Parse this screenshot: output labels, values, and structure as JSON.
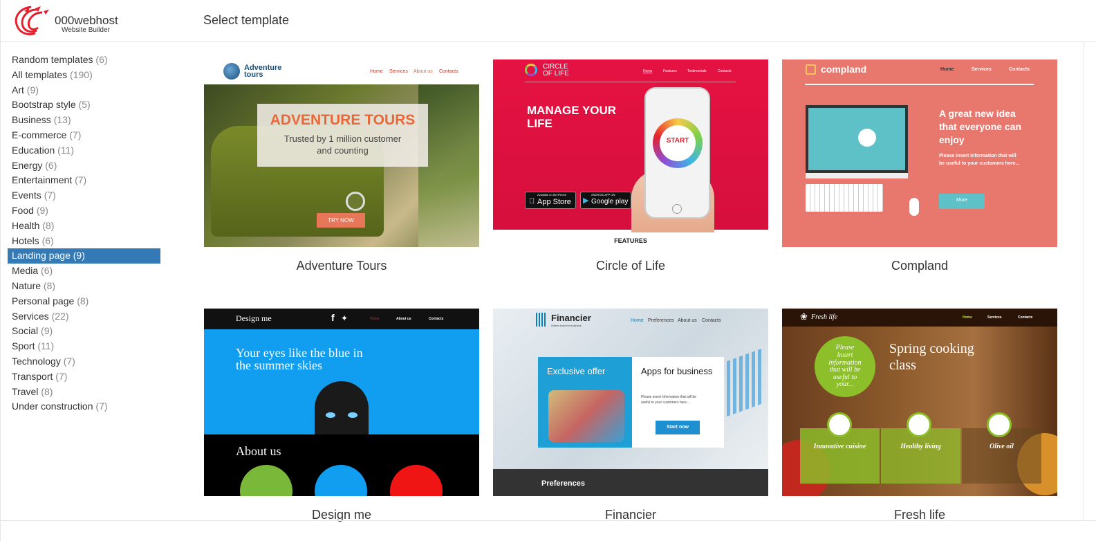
{
  "header": {
    "brand": "000webhost",
    "brand_sub": "Website Builder",
    "page_title": "Select template"
  },
  "categories": [
    {
      "label": "Random templates",
      "count": "(6)"
    },
    {
      "label": "All templates",
      "count": "(190)"
    },
    {
      "label": "Art",
      "count": "(9)"
    },
    {
      "label": "Bootstrap style",
      "count": "(5)"
    },
    {
      "label": "Business",
      "count": "(13)"
    },
    {
      "label": "E-commerce",
      "count": "(7)"
    },
    {
      "label": "Education",
      "count": "(11)"
    },
    {
      "label": "Energy",
      "count": "(6)"
    },
    {
      "label": "Entertainment",
      "count": "(7)"
    },
    {
      "label": "Events",
      "count": "(7)"
    },
    {
      "label": "Food",
      "count": "(9)"
    },
    {
      "label": "Health",
      "count": "(8)"
    },
    {
      "label": "Hotels",
      "count": "(6)"
    },
    {
      "label": "Landing page",
      "count": "(9)"
    },
    {
      "label": "Media",
      "count": "(6)"
    },
    {
      "label": "Nature",
      "count": "(8)"
    },
    {
      "label": "Personal page",
      "count": "(8)"
    },
    {
      "label": "Services",
      "count": "(22)"
    },
    {
      "label": "Social",
      "count": "(9)"
    },
    {
      "label": "Sport",
      "count": "(11)"
    },
    {
      "label": "Technology",
      "count": "(7)"
    },
    {
      "label": "Transport",
      "count": "(7)"
    },
    {
      "label": "Travel",
      "count": "(8)"
    },
    {
      "label": "Under construction",
      "count": "(7)"
    }
  ],
  "active_category": "Landing page",
  "templates": {
    "adventure": {
      "name": "Adventure Tours",
      "logo": "Adventure tours",
      "nav": [
        "Home",
        "Services",
        "About us",
        "Contacts"
      ],
      "headline": "ADVENTURE TOURS",
      "sub1": "Trusted by 1 million customer",
      "sub2": "and counting",
      "cta": "TRY NOW"
    },
    "circle": {
      "name": "Circle of Life",
      "logo1": "CIRCLE",
      "logo2": "OF LIFE",
      "nav": [
        "Home",
        "Features",
        "Testimonials",
        "Contacts"
      ],
      "headline1": "MANAGE YOUR",
      "headline2": "LIFE",
      "start": "START",
      "appstore_small": "Available on the iPhone",
      "appstore": "App Store",
      "gplay_small": "ANDROID APP ON",
      "gplay": "Google play",
      "features": "FEATURES"
    },
    "compland": {
      "name": "Compland",
      "logo": "compland",
      "nav": [
        "Home",
        "Services",
        "Contacts"
      ],
      "headline": [
        "A great new idea",
        "that everyone can",
        "enjoy"
      ],
      "body": [
        "Please insert information that will",
        "be useful to your customers here..."
      ],
      "cta": "More"
    },
    "design": {
      "name": "Design me",
      "logo": "Design me",
      "nav": [
        "Home",
        "About us",
        "Contacts"
      ],
      "headline1": "Your eyes like the blue in",
      "headline2": "the summer skies",
      "about": "About us"
    },
    "financier": {
      "name": "Financier",
      "logo": "Financier",
      "tagline": "Online tools for business",
      "nav": [
        "Home",
        "Preferences",
        "About us",
        "Contacts"
      ],
      "offer": "Exclusive offer",
      "apps": "Apps for business",
      "body": [
        "Please insert information that will be",
        "useful to your customers here..."
      ],
      "cta": "Start now",
      "prefs": "Preferences"
    },
    "fresh": {
      "name": "Fresh life",
      "logo": "Fresh life",
      "nav": [
        "Home",
        "Services",
        "Contacts"
      ],
      "circle_text": [
        "Please",
        "insert",
        "information",
        "that will be",
        "useful to",
        "your..."
      ],
      "headline1": "Spring cooking",
      "headline2": "class",
      "cols": [
        "Innovative cuisine",
        "Healthy living",
        "Olive oil"
      ]
    }
  },
  "colors": {
    "active_bg": "#337ab7",
    "circle_pink": "#e0123f",
    "compland_salmon": "#e8776e",
    "design_blue": "#119ef0",
    "adventure_orange": "#e8683a"
  }
}
